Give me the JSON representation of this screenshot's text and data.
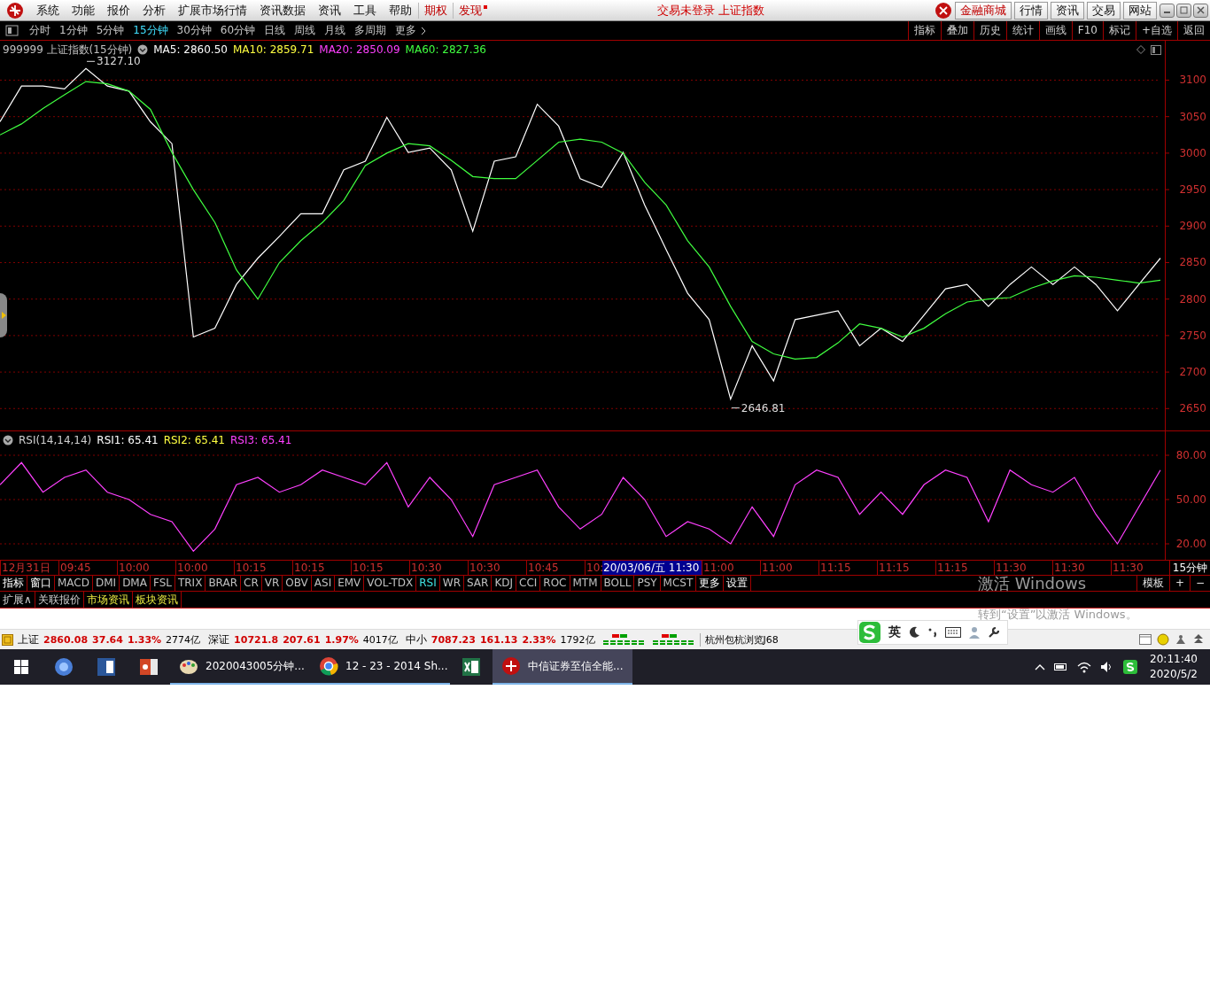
{
  "menu_bar": {
    "items": [
      "系统",
      "功能",
      "报价",
      "分析",
      "扩展市场行情",
      "资讯数据",
      "资讯",
      "工具",
      "帮助"
    ],
    "special": [
      {
        "label": "期权",
        "badge": false
      },
      {
        "label": "发现",
        "badge": true
      }
    ],
    "title": "交易未登录 上证指数",
    "buttons": [
      {
        "label": "金融商城",
        "highlight": true
      },
      {
        "label": "行情",
        "highlight": false
      },
      {
        "label": "资讯",
        "highlight": false
      },
      {
        "label": "交易",
        "highlight": false
      },
      {
        "label": "网站",
        "highlight": false
      }
    ]
  },
  "period_bar": {
    "periods": [
      {
        "label": "分时",
        "selected": false
      },
      {
        "label": "1分钟",
        "selected": false
      },
      {
        "label": "5分钟",
        "selected": false
      },
      {
        "label": "15分钟",
        "selected": true
      },
      {
        "label": "30分钟",
        "selected": false
      },
      {
        "label": "60分钟",
        "selected": false
      },
      {
        "label": "日线",
        "selected": false
      },
      {
        "label": "周线",
        "selected": false
      },
      {
        "label": "月线",
        "selected": false
      },
      {
        "label": "多周期",
        "selected": false
      },
      {
        "label": "更多",
        "selected": false
      }
    ],
    "tools": [
      "指标",
      "叠加",
      "历史",
      "统计",
      "画线",
      "F10",
      "标记",
      "+自选",
      "返回"
    ]
  },
  "price_panel": {
    "title": "999999 上证指数(15分钟)",
    "legend": [
      {
        "kind": "series",
        "reading": ": 2860.50"
      },
      {
        "kind": "extra",
        "name": "MA10",
        "reading": ": 2859.71",
        "color": "#ffff40"
      },
      {
        "kind": "extra",
        "name": "MA20",
        "reading": ": 2850.09",
        "color": "#ff40ff"
      },
      {
        "kind": "series",
        "reading": ": 2827.36"
      }
    ],
    "chart_data": {
      "type": "line",
      "categories": [
        null,
        null,
        null,
        null,
        null,
        null,
        null,
        null,
        null,
        null,
        null,
        null,
        null,
        null,
        null,
        null,
        null,
        null,
        null,
        null,
        null,
        null,
        null,
        null,
        null,
        null,
        null,
        null,
        null,
        null,
        null,
        null,
        null,
        null,
        null,
        null,
        null,
        null,
        null,
        null,
        null,
        null,
        null,
        null,
        null,
        null,
        null,
        null,
        null,
        null,
        null,
        null,
        null,
        null,
        null
      ],
      "series": [
        {
          "name": "MA5",
          "color": "#ffffff",
          "values": [
            3043,
            3092,
            3092,
            3088,
            3116,
            3092,
            3085,
            3043,
            3013,
            2748,
            2760,
            2820,
            2856,
            2886,
            2917,
            2917,
            2977,
            2989,
            3049,
            3001,
            3007,
            2977,
            2893,
            2989,
            2995,
            3067,
            3037,
            2965,
            2953,
            3001,
            2929,
            2868,
            2808,
            2772,
            2663,
            2736,
            2688,
            2772,
            2778,
            2784,
            2736,
            2760,
            2742,
            2778,
            2814,
            2820,
            2790,
            2820,
            2844,
            2820,
            2844,
            2820,
            2784,
            2820,
            2856
          ]
        },
        {
          "name": "MA60",
          "color": "#40ff40",
          "values": [
            3025,
            3040,
            3061,
            3080,
            3098,
            3095,
            3085,
            3060,
            3001,
            2950,
            2905,
            2840,
            2800,
            2850,
            2880,
            2905,
            2935,
            2983,
            3000,
            3013,
            3010,
            2990,
            2968,
            2965,
            2965,
            2990,
            3015,
            3019,
            3015,
            3000,
            2960,
            2929,
            2880,
            2844,
            2790,
            2742,
            2725,
            2718,
            2720,
            2740,
            2766,
            2760,
            2748,
            2760,
            2780,
            2796,
            2800,
            2802,
            2815,
            2825,
            2832,
            2830,
            2826,
            2822,
            2826
          ]
        }
      ],
      "ylim": [
        2620,
        3154
      ],
      "grid": true,
      "yticks": [
        2650,
        2700,
        2750,
        2800,
        2850,
        2900,
        2950,
        3000,
        3050,
        3100
      ],
      "annotations": [
        "3127.10",
        "2646.81"
      ]
    }
  },
  "rsi_panel": {
    "title": "RSI(14,14,14)",
    "legend": [
      {
        "kind": "extra",
        "name": "RSI1",
        "reading": ": 65.41",
        "color": "#ffffff"
      },
      {
        "kind": "extra",
        "name": "RSI2",
        "reading": ": 65.41",
        "color": "#ffff40"
      },
      {
        "kind": "series",
        "reading": ": 65.41"
      }
    ],
    "chart_data": {
      "type": "line",
      "categories": [
        null,
        null,
        null,
        null,
        null,
        null,
        null,
        null,
        null,
        null,
        null,
        null,
        null,
        null,
        null,
        null,
        null,
        null,
        null,
        null,
        null,
        null,
        null,
        null,
        null,
        null,
        null,
        null,
        null,
        null,
        null,
        null,
        null,
        null,
        null,
        null,
        null,
        null,
        null,
        null,
        null,
        null,
        null,
        null,
        null,
        null,
        null,
        null,
        null,
        null,
        null,
        null,
        null,
        null,
        null
      ],
      "series": [
        {
          "name": "RSI3",
          "color": "#ff40ff",
          "values": [
            60,
            75,
            55,
            65,
            70,
            55,
            50,
            40,
            35,
            15,
            30,
            60,
            65,
            55,
            60,
            70,
            65,
            60,
            75,
            45,
            65,
            50,
            25,
            60,
            65,
            70,
            45,
            30,
            40,
            65,
            50,
            25,
            35,
            30,
            20,
            45,
            25,
            60,
            70,
            65,
            40,
            55,
            40,
            60,
            70,
            65,
            35,
            70,
            60,
            55,
            65,
            40,
            20,
            45,
            70
          ]
        }
      ],
      "ylim": [
        9.2,
        96.2
      ],
      "grid": true,
      "yticks": [
        {
          "value": 20,
          "label": "20.00"
        },
        {
          "value": 50,
          "label": "50.00"
        },
        {
          "value": 80,
          "label": "80.00"
        }
      ]
    }
  },
  "time_axis": {
    "labels": [
      {
        "text": "12月31日",
        "kind": "tick"
      },
      {
        "text": "09:45",
        "kind": "tick"
      },
      {
        "text": "10:00",
        "kind": "tick"
      },
      {
        "text": "10:00",
        "kind": "tick"
      },
      {
        "text": "10:15",
        "kind": "tick"
      },
      {
        "text": "10:15",
        "kind": "tick"
      },
      {
        "text": "10:15",
        "kind": "tick"
      },
      {
        "text": "10:30",
        "kind": "tick"
      },
      {
        "text": "10:30",
        "kind": "tick"
      },
      {
        "text": "10:45",
        "kind": "tick"
      },
      {
        "text": "10:",
        "kind": "cut"
      },
      {
        "text": "20/03/06/五 11:30",
        "kind": "cursor"
      },
      {
        "text": "11:00",
        "kind": "tick"
      },
      {
        "text": "11:00",
        "kind": "tick"
      },
      {
        "text": "11:15",
        "kind": "tick"
      },
      {
        "text": "11:15",
        "kind": "tick"
      },
      {
        "text": "11:15",
        "kind": "tick"
      },
      {
        "text": "11:30",
        "kind": "tick"
      },
      {
        "text": "11:30",
        "kind": "tick"
      },
      {
        "text": "11:30",
        "kind": "tick"
      }
    ],
    "period": "15分钟"
  },
  "indicator_tabs": [
    {
      "label": "指标",
      "kind": "command",
      "selected": false
    },
    {
      "label": "窗口",
      "kind": "command",
      "selected": false
    },
    {
      "label": "MACD",
      "kind": "indicator",
      "selected": false
    },
    {
      "label": "DMI",
      "kind": "indicator",
      "selected": false
    },
    {
      "label": "DMA",
      "kind": "indicator",
      "selected": false
    },
    {
      "label": "FSL",
      "kind": "indicator",
      "selected": false
    },
    {
      "label": "TRIX",
      "kind": "indicator",
      "selected": false
    },
    {
      "label": "BRAR",
      "kind": "indicator",
      "selected": false
    },
    {
      "label": "CR",
      "kind": "indicator",
      "selected": false
    },
    {
      "label": "VR",
      "kind": "indicator",
      "selected": false
    },
    {
      "label": "OBV",
      "kind": "indicator",
      "selected": false
    },
    {
      "label": "ASI",
      "kind": "indicator",
      "selected": false
    },
    {
      "label": "EMV",
      "kind": "indicator",
      "selected": false
    },
    {
      "label": "VOL-TDX",
      "kind": "indicator",
      "selected": false
    },
    {
      "label": "RSI",
      "kind": "indicator",
      "selected": true
    },
    {
      "label": "WR",
      "kind": "indicator",
      "selected": false
    },
    {
      "label": "SAR",
      "kind": "indicator",
      "selected": false
    },
    {
      "label": "KDJ",
      "kind": "indicator",
      "selected": false
    },
    {
      "label": "CCI",
      "kind": "indicator",
      "selected": false
    },
    {
      "label": "ROC",
      "kind": "indicator",
      "selected": false
    },
    {
      "label": "MTM",
      "kind": "indicator",
      "selected": false
    },
    {
      "label": "BOLL",
      "kind": "indicator",
      "selected": false
    },
    {
      "label": "PSY",
      "kind": "indicator",
      "selected": false
    },
    {
      "label": "MCST",
      "kind": "indicator",
      "selected": false
    },
    {
      "label": "更多",
      "kind": "command",
      "selected": false
    },
    {
      "label": "设置",
      "kind": "command",
      "selected": false
    }
  ],
  "window_buttons": [
    "模板",
    "+",
    "−"
  ],
  "ext_tabs": [
    {
      "label": "扩展∧",
      "kind": "plain"
    },
    {
      "label": "关联报价",
      "kind": "plain"
    },
    {
      "label": "市场资讯",
      "kind": "news"
    },
    {
      "label": "板块资讯",
      "kind": "news"
    }
  ],
  "activation_notice": {
    "title": "激活 Windows",
    "hint": "转到“设置”以激活 Windows。"
  },
  "status_bar": {
    "indices": [
      {
        "name": "上证",
        "value": "2860.08",
        "change": "37.64",
        "percent": "1.33%",
        "amount": "2774亿"
      },
      {
        "name": "深证",
        "value": "10721.8",
        "change": "207.61",
        "percent": "1.97%",
        "amount": "4017亿"
      },
      {
        "name": "中小",
        "value": "7087.23",
        "change": "161.13",
        "percent": "2.33%",
        "amount": "1792亿"
      }
    ],
    "ticker": "杭州包杭浏览J68",
    "ime_mode": "英"
  },
  "taskbar": {
    "apps": [
      {
        "kind": "browser",
        "selected": false
      },
      {
        "kind": "word",
        "selected": false
      },
      {
        "kind": "slides",
        "selected": false
      },
      {
        "kind": "paint",
        "label": "2020043005分钟...",
        "selected": false
      },
      {
        "kind": "chrome",
        "label": "12 - 23 - 2014 Sh...",
        "selected": false
      },
      {
        "kind": "excel",
        "selected": false
      },
      {
        "kind": "trader",
        "label": "中信证券至信全能...",
        "selected": true
      }
    ],
    "time": "20:11:40",
    "date": "2020/5/2"
  }
}
